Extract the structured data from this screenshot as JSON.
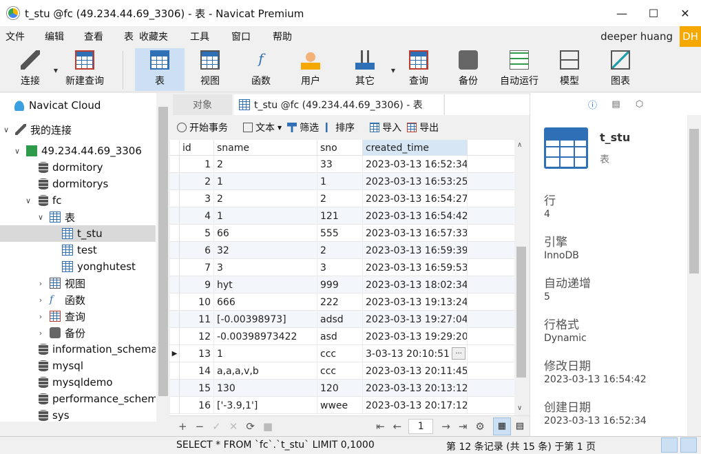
{
  "window": {
    "title": "t_stu @fc (49.234.44.69_3306) - 表 - Navicat Premium"
  },
  "menu": [
    "文件",
    "编辑",
    "查看",
    "表",
    "收藏夹",
    "工具",
    "窗口",
    "帮助"
  ],
  "user": {
    "name": "deeper huang",
    "initials": "DH"
  },
  "toolbar": [
    {
      "label": "连接",
      "icon": "plug-icon"
    },
    {
      "label": "新建查询",
      "icon": "new-query-icon"
    },
    {
      "label": "表",
      "icon": "table-icon"
    },
    {
      "label": "视图",
      "icon": "view-icon"
    },
    {
      "label": "函数",
      "icon": "function-icon"
    },
    {
      "label": "用户",
      "icon": "user-icon"
    },
    {
      "label": "其它",
      "icon": "tools-icon"
    },
    {
      "label": "查询",
      "icon": "query-icon"
    },
    {
      "label": "备份",
      "icon": "backup-icon"
    },
    {
      "label": "自动运行",
      "icon": "schedule-icon"
    },
    {
      "label": "模型",
      "icon": "model-icon"
    },
    {
      "label": "图表",
      "icon": "chart-icon"
    }
  ],
  "tree": {
    "cloud": "Navicat Cloud",
    "my_connections": "我的连接",
    "connection": "49.234.44.69_3306",
    "dbs_top": [
      "dormitory",
      "dormitorys"
    ],
    "fc": "fc",
    "tables_group": "表",
    "tables": [
      "t_stu",
      "test",
      "yonghutest"
    ],
    "groups": [
      "视图",
      "函数",
      "查询",
      "备份"
    ],
    "dbs_bottom": [
      "information_schema",
      "mysql",
      "mysqldemo",
      "performance_schema",
      "sys"
    ]
  },
  "tabs": {
    "objects": "对象",
    "active": "t_stu @fc (49.234.44.69_3306) - 表"
  },
  "actions": {
    "begin_tx": "开始事务",
    "text": "文本",
    "filter": "筛选",
    "sort": "排序",
    "import": "导入",
    "export": "导出"
  },
  "grid": {
    "columns": [
      "id",
      "sname",
      "sno",
      "created_time"
    ],
    "rows": [
      [
        "1",
        "2",
        "33",
        "2023-03-13 16:52:34"
      ],
      [
        "2",
        "1",
        "1",
        "2023-03-13 16:53:25"
      ],
      [
        "3",
        "2",
        "2",
        "2023-03-13 16:54:27"
      ],
      [
        "4",
        "1",
        "121",
        "2023-03-13 16:54:42"
      ],
      [
        "5",
        "66",
        "555",
        "2023-03-13 16:57:33"
      ],
      [
        "6",
        "32",
        "2",
        "2023-03-13 16:59:39"
      ],
      [
        "7",
        "3",
        "3",
        "2023-03-13 16:59:53"
      ],
      [
        "9",
        "hyt",
        "999",
        "2023-03-13 18:02:34"
      ],
      [
        "10",
        "666",
        "222",
        "2023-03-13 19:13:24"
      ],
      [
        "11",
        "[-0.00398973]",
        "adsd",
        "2023-03-13 19:27:04"
      ],
      [
        "12",
        "-0.00398973422",
        "asd",
        "2023-03-13 19:29:20"
      ],
      [
        "13",
        "1",
        "ccc",
        "3-03-13 20:10:51"
      ],
      [
        "14",
        "a,a,a,v,b",
        "ccc",
        "2023-03-13 20:11:45"
      ],
      [
        "15",
        "130",
        "120",
        "2023-03-13 20:13:12"
      ],
      [
        "16",
        "['-3.9,1']",
        "wwee",
        "2023-03-13 20:17:12"
      ]
    ],
    "current_row": 11,
    "ellipsis": "···"
  },
  "footer": {
    "page": "1"
  },
  "info": {
    "name": "t_stu",
    "type": "表",
    "fields": [
      {
        "label": "行",
        "value": "4"
      },
      {
        "label": "引擎",
        "value": "InnoDB"
      },
      {
        "label": "自动递增",
        "value": "5"
      },
      {
        "label": "行格式",
        "value": "Dynamic"
      },
      {
        "label": "修改日期",
        "value": "2023-03-13 16:54:42"
      },
      {
        "label": "创建日期",
        "value": "2023-03-13 16:52:34"
      }
    ]
  },
  "status": {
    "sql": "SELECT * FROM `fc`.`t_stu` LIMIT 0,1000",
    "records": "第 12 条记录 (共 15 条) 于第 1 页"
  },
  "colors": {
    "accent": "#2f6fb5",
    "active_bg": "#cde0f3",
    "badge": "#f5a800"
  }
}
